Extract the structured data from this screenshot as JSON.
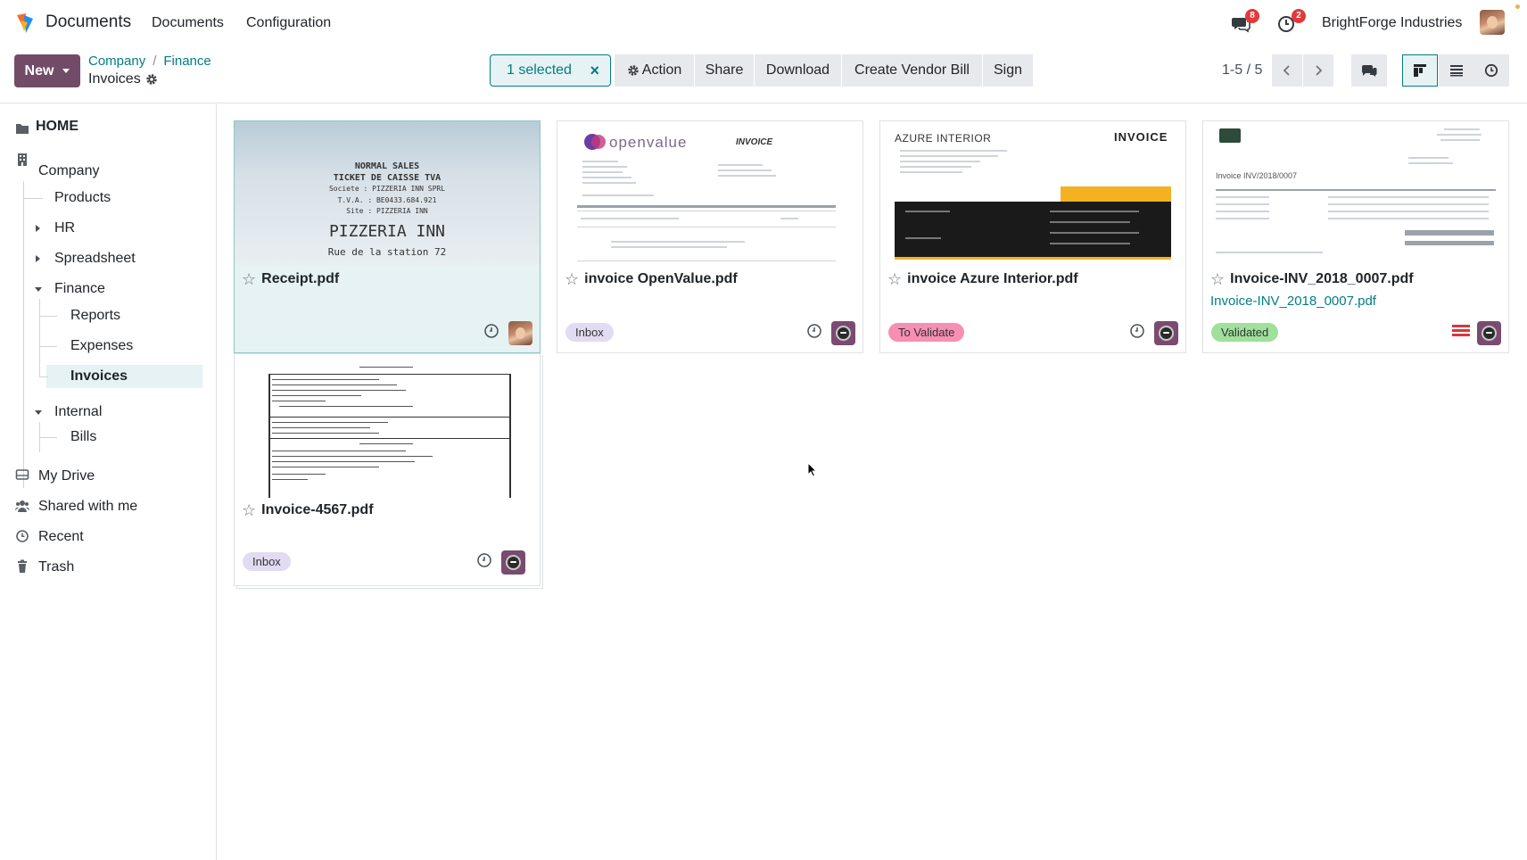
{
  "app": {
    "name": "Documents"
  },
  "menu": {
    "items": [
      "Documents",
      "Configuration"
    ]
  },
  "systray": {
    "messages_count": "8",
    "activities_count": "2",
    "company": "BrightForge Industries"
  },
  "control": {
    "new_label": "New",
    "breadcrumb": [
      "Company",
      "Finance"
    ],
    "current": "Invoices",
    "selected_label": "1 selected",
    "actions": [
      "Action",
      "Share",
      "Download",
      "Create Vendor Bill",
      "Sign"
    ],
    "pager": "1-5 / 5"
  },
  "sidebar": {
    "home": "HOME",
    "company": "Company",
    "products": "Products",
    "hr": "HR",
    "spreadsheet": "Spreadsheet",
    "finance": "Finance",
    "reports": "Reports",
    "expenses": "Expenses",
    "invoices": "Invoices",
    "internal": "Internal",
    "bills": "Bills",
    "my_drive": "My Drive",
    "shared": "Shared with me",
    "recent": "Recent",
    "trash": "Trash"
  },
  "cards": [
    {
      "title": "Receipt.pdf",
      "tag": "",
      "subtitle": ""
    },
    {
      "title": "invoice OpenValue.pdf",
      "tag": "Inbox",
      "subtitle": ""
    },
    {
      "title": "invoice Azure Interior.pdf",
      "tag": "To Validate",
      "subtitle": ""
    },
    {
      "title": "Invoice-INV_2018_0007.pdf",
      "tag": "Validated",
      "subtitle": "Invoice-INV_2018_0007.pdf"
    },
    {
      "title": "Invoice-4567.pdf",
      "tag": "Inbox",
      "subtitle": ""
    }
  ],
  "thumbs": {
    "receipt_lines": [
      "NORMAL SALES",
      "TICKET DE CAISSE TVA",
      "Societe : PIZZERIA INN SPRL",
      "T.V.A. : BE0433.684.921",
      "Site : PIZZERIA INN",
      "PIZZERIA INN",
      "Rue de la station 72"
    ],
    "openvalue_logo": "openvalue",
    "openvalue_invoice": "INVOICE",
    "azure_company": "AZURE INTERIOR",
    "azure_invoice": "INVOICE",
    "inv2018_heading": "Invoice INV/2018/0007"
  },
  "colors": {
    "brand": "#714b67",
    "accent": "#017e84",
    "inbox_tag": "#e2dcf2",
    "validate_tag": "#f68fb3",
    "validated_tag": "#9fe09b"
  }
}
